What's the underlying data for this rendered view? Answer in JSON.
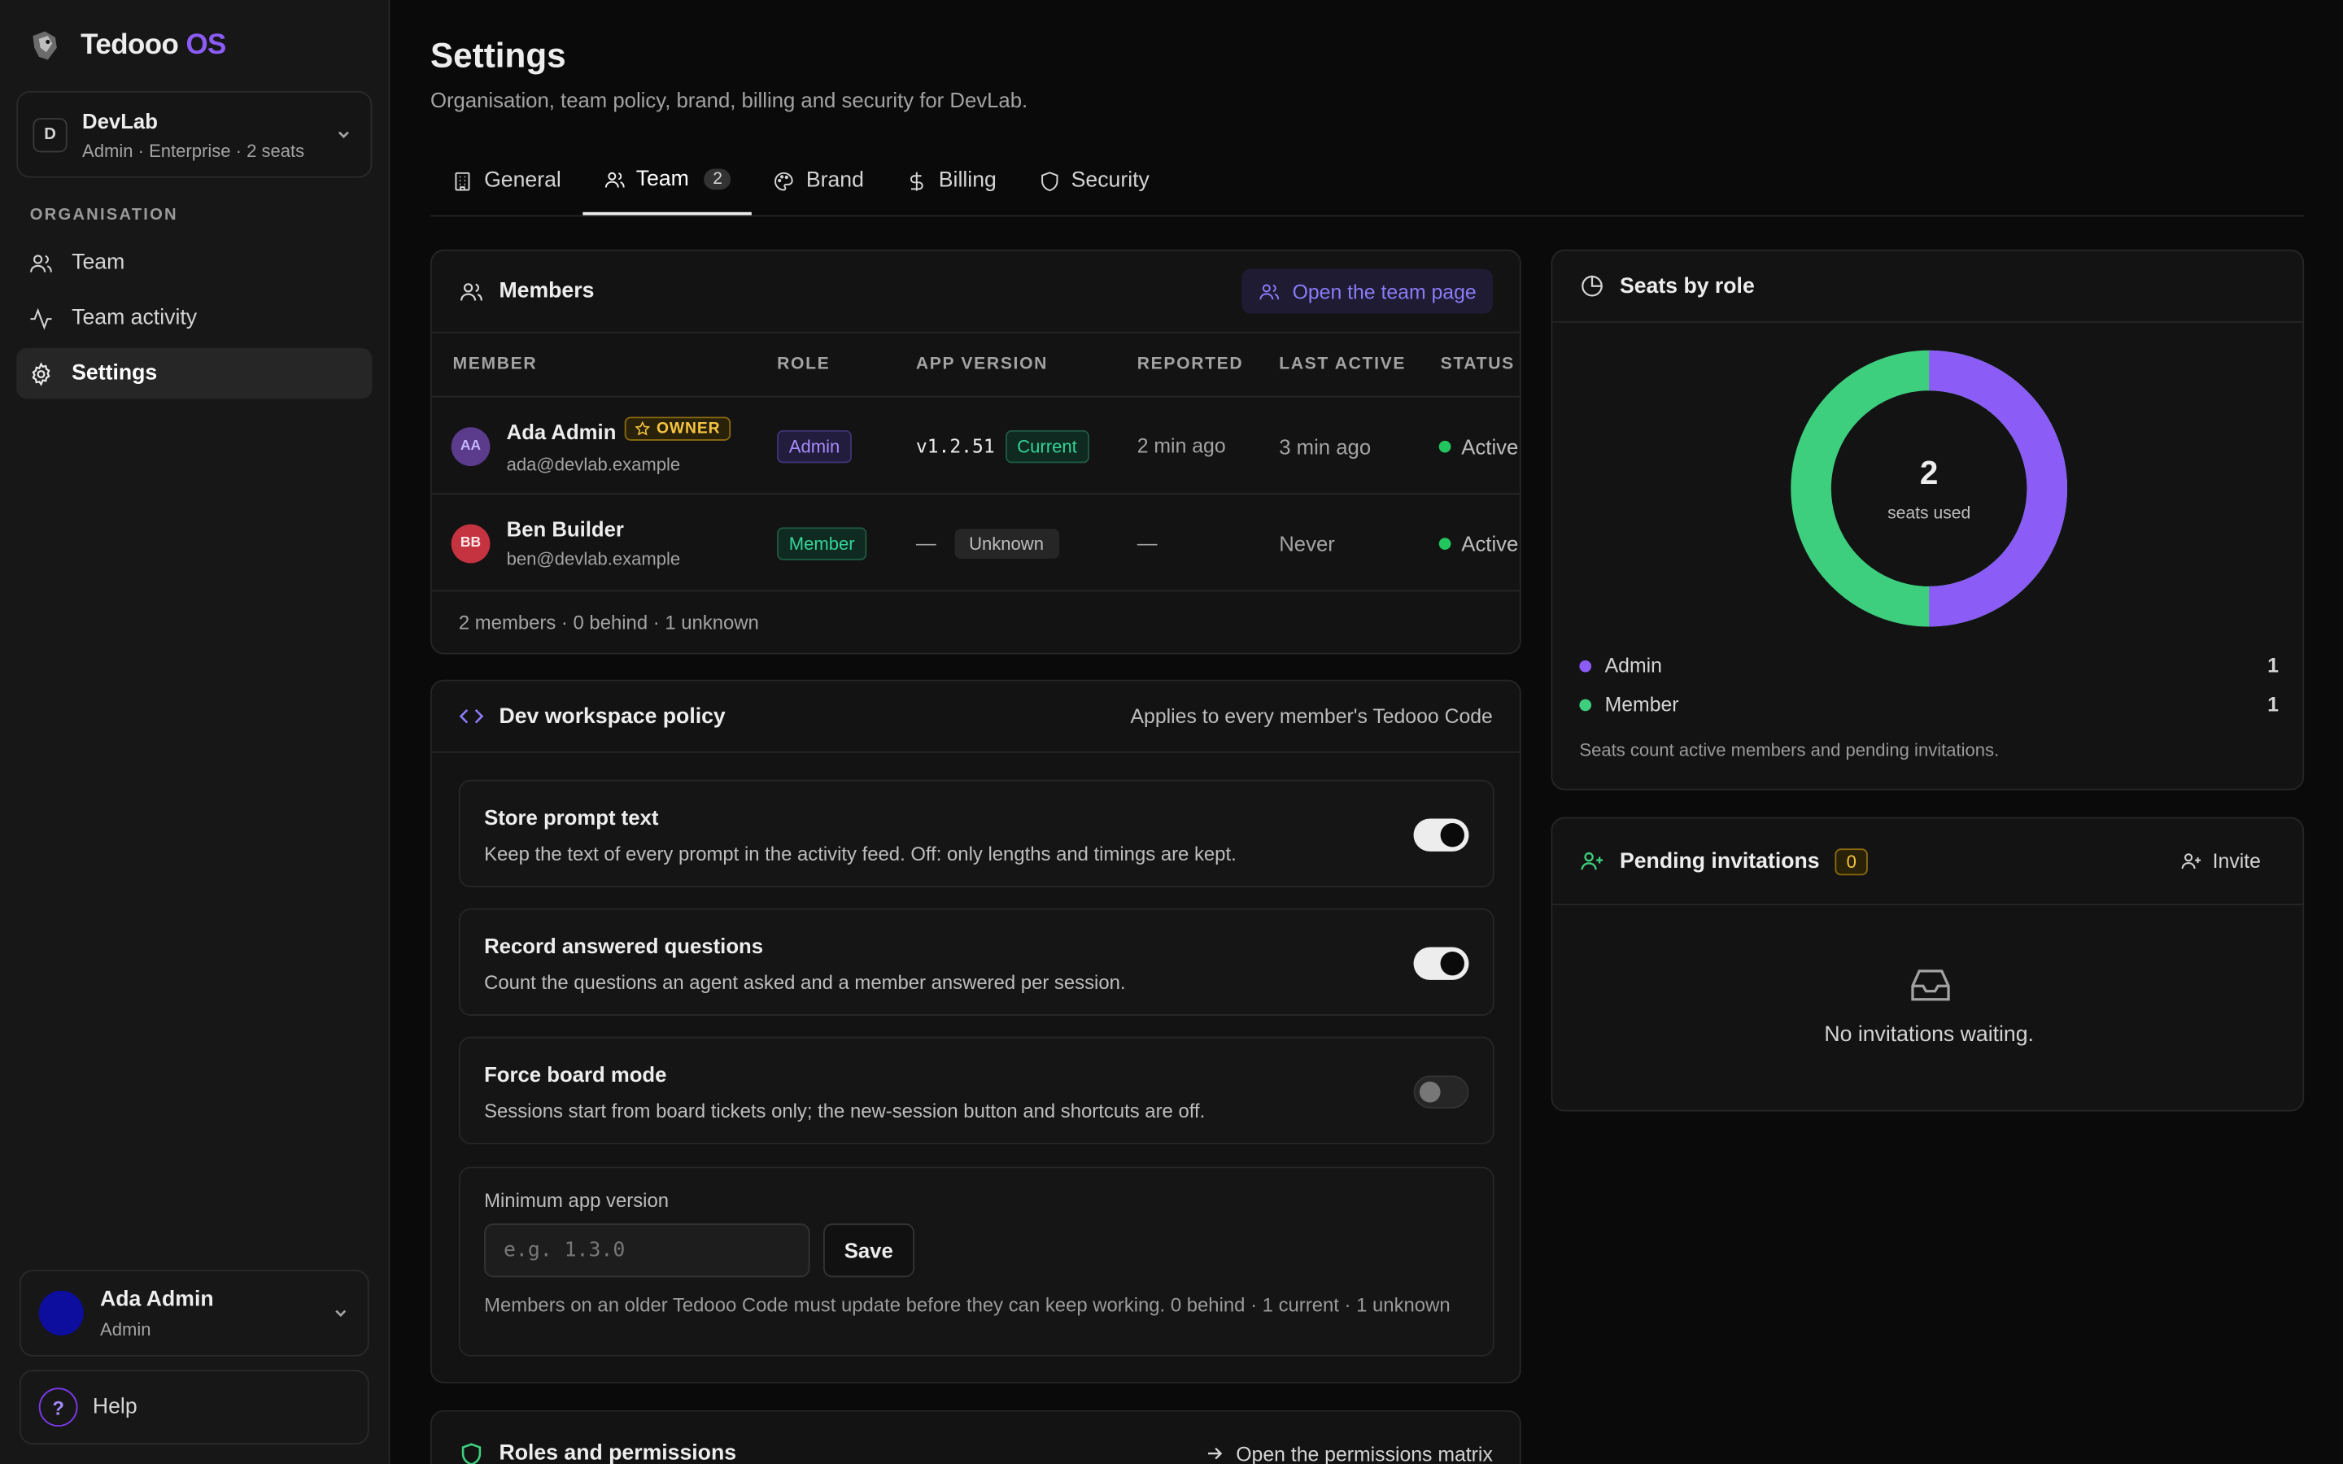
{
  "brand": {
    "name": "Tedooo",
    "suffix": "OS"
  },
  "org": {
    "initial": "D",
    "name": "DevLab",
    "sub": "Admin · Enterprise · 2 seats"
  },
  "sidebar": {
    "section_label": "ORGANISATION",
    "items": [
      {
        "label": "Team",
        "icon": "users-icon"
      },
      {
        "label": "Team activity",
        "icon": "activity-icon"
      },
      {
        "label": "Settings",
        "icon": "gear-icon",
        "active": true
      }
    ]
  },
  "user": {
    "name": "Ada Admin",
    "role": "Admin"
  },
  "help": {
    "label": "Help",
    "glyph": "?"
  },
  "page": {
    "title": "Settings",
    "subtitle": "Organisation, team policy, brand, billing and security for DevLab."
  },
  "tabs": [
    {
      "label": "General",
      "icon": "building-icon"
    },
    {
      "label": "Team",
      "icon": "users-icon",
      "count": "2",
      "active": true
    },
    {
      "label": "Brand",
      "icon": "palette-icon"
    },
    {
      "label": "Billing",
      "icon": "dollar-icon"
    },
    {
      "label": "Security",
      "icon": "shield-icon"
    }
  ],
  "members": {
    "title": "Members",
    "open_button": "Open the team page",
    "columns": [
      "MEMBER",
      "ROLE",
      "APP VERSION",
      "REPORTED",
      "LAST ACTIVE",
      "STATUS"
    ],
    "rows": [
      {
        "initials": "AA",
        "name": "Ada Admin",
        "badge": "OWNER",
        "email": "ada@devlab.example",
        "role": "Admin",
        "version": "v1.2.51",
        "version_tag": "Current",
        "reported": "2 min ago",
        "last_active": "3 min ago",
        "status": "Active",
        "avatar_color": "#5b3b8c"
      },
      {
        "initials": "BB",
        "name": "Ben Builder",
        "email": "ben@devlab.example",
        "role": "Member",
        "version": "—",
        "version_tag": "Unknown",
        "reported": "—",
        "last_active": "Never",
        "status": "Active",
        "avatar_color": "#c53340"
      }
    ],
    "footer": "2 members · 0 behind · 1 unknown"
  },
  "policy": {
    "title": "Dev workspace policy",
    "note": "Applies to every member's Tedooo Code",
    "items": [
      {
        "title": "Store prompt text",
        "desc": "Keep the text of every prompt in the activity feed. Off: only lengths and timings are kept.",
        "enabled": true
      },
      {
        "title": "Record answered questions",
        "desc": "Count the questions an agent asked and a member answered per session.",
        "enabled": true
      },
      {
        "title": "Force board mode",
        "desc": "Sessions start from board tickets only; the new-session button and shortcuts are off.",
        "enabled": false
      }
    ],
    "min_version": {
      "label": "Minimum app version",
      "placeholder": "e.g. 1.3.0",
      "save": "Save",
      "note": "Members on an older Tedooo Code must update before they can keep working. 0 behind · 1 current · 1 unknown"
    }
  },
  "roles": {
    "title": "Roles and permissions",
    "link": "Open the permissions matrix"
  },
  "seats": {
    "title": "Seats by role",
    "used": "2",
    "used_label": "seats used",
    "legend": [
      {
        "label": "Admin",
        "value": "1",
        "color": "#8b5cf6"
      },
      {
        "label": "Member",
        "value": "1",
        "color": "#3ecf7e"
      }
    ],
    "note": "Seats count active members and pending invitations."
  },
  "pending": {
    "title": "Pending invitations",
    "count": "0",
    "invite": "Invite",
    "empty": "No invitations waiting."
  },
  "colors": {
    "accent": "#8b5cf6",
    "success": "#22c55e",
    "warning": "#f5c542"
  }
}
